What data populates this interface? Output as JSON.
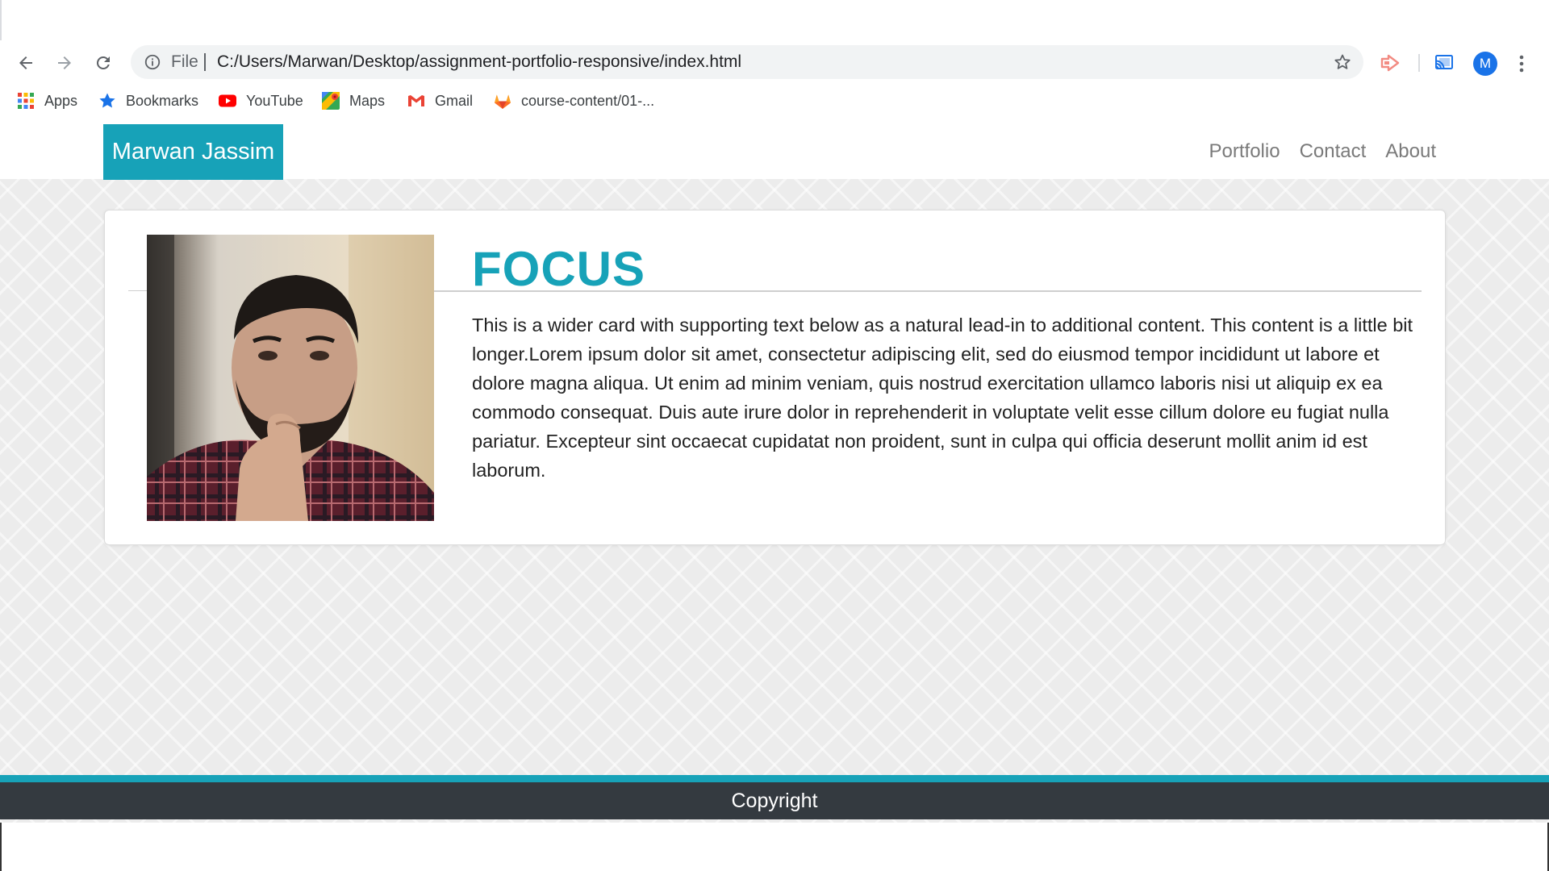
{
  "browser": {
    "address_scheme": "File",
    "address_url": "C:/Users/Marwan/Desktop/assignment-portfolio-responsive/index.html",
    "profile_initial": "M",
    "bookmarks": [
      {
        "label": "Apps",
        "icon": "apps-grid-icon"
      },
      {
        "label": "Bookmarks",
        "icon": "star-icon"
      },
      {
        "label": "YouTube",
        "icon": "youtube-icon"
      },
      {
        "label": "Maps",
        "icon": "maps-icon"
      },
      {
        "label": "Gmail",
        "icon": "gmail-icon"
      },
      {
        "label": "course-content/01-...",
        "icon": "gitlab-icon"
      }
    ]
  },
  "site": {
    "brand": "Marwan Jassim",
    "nav": [
      "Portfolio",
      "Contact",
      "About"
    ],
    "card": {
      "title": "FOCUS",
      "text": "This is a wider card with supporting text below as a natural lead-in to additional content. This content is a little bit longer.Lorem ipsum dolor sit amet, consectetur adipiscing elit, sed do eiusmod tempor incididunt ut labore et dolore magna aliqua. Ut enim ad minim veniam, quis nostrud exercitation ullamco laboris nisi ut aliquip ex ea commodo consequat. Duis aute irure dolor in reprehenderit in voluptate velit esse cillum dolore eu fugiat nulla pariatur. Excepteur sint occaecat cupidatat non proident, sunt in culpa qui officia deserunt mollit anim id est laborum."
    },
    "footer": "Copyright"
  },
  "colors": {
    "accent": "#17a2b8",
    "footer_bg": "#343a40",
    "page_bg": "#ececec"
  }
}
